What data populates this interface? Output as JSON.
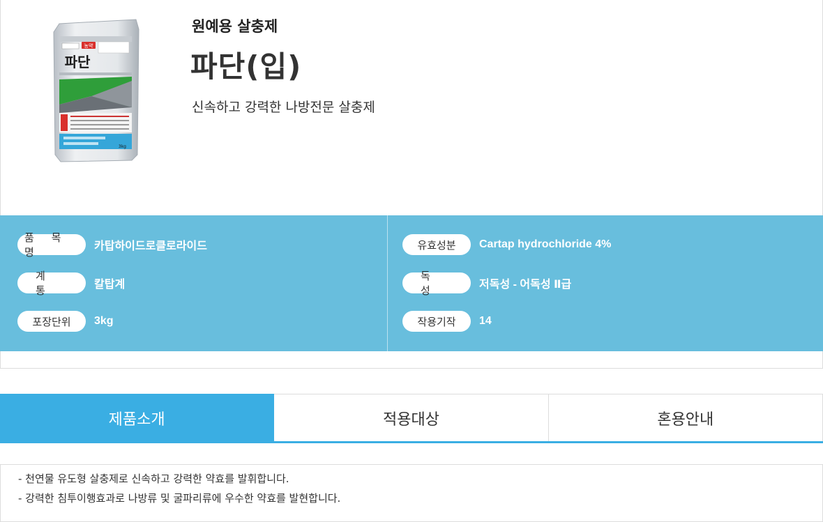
{
  "product": {
    "category": "원예용 살충제",
    "name": "파단(입)",
    "tagline": "신속하고 강력한 나방전문 살충제",
    "image": {
      "bag_title": "파단",
      "brand_badge": "농약",
      "weight_label": "3kg",
      "colors": {
        "bag": "#d9dde2",
        "stripe_green": "#2f9e3a",
        "stripe_gray": "#8f959b",
        "stripe_blue": "#35a6d9",
        "badge_red": "#d9302c"
      }
    }
  },
  "info": {
    "left": [
      {
        "label": "품 목 명",
        "value": "카탑하이드로클로라이드"
      },
      {
        "label": "계 통",
        "value": "칼탑계"
      },
      {
        "label": "포장단위",
        "value": "3kg"
      }
    ],
    "right": [
      {
        "label": "유효성분",
        "value": "Cartap hydrochloride 4%"
      },
      {
        "label": "독 성",
        "value": "저독성 - 어독성 Ⅱ급"
      },
      {
        "label": "작용기작",
        "value": "14"
      }
    ]
  },
  "tabs": [
    {
      "label": "제품소개",
      "active": true
    },
    {
      "label": "적용대상",
      "active": false
    },
    {
      "label": "혼용안내",
      "active": false
    }
  ],
  "description": [
    "- 천연물 유도형 살충제로 신속하고 강력한 약효를 발휘합니다.",
    "- 강력한 침투이행효과로 나방류 및 굴파리류에 우수한 약효를 발현합니다."
  ],
  "colors": {
    "info_panel": "#68bedd",
    "tab_active": "#3aaee3"
  }
}
